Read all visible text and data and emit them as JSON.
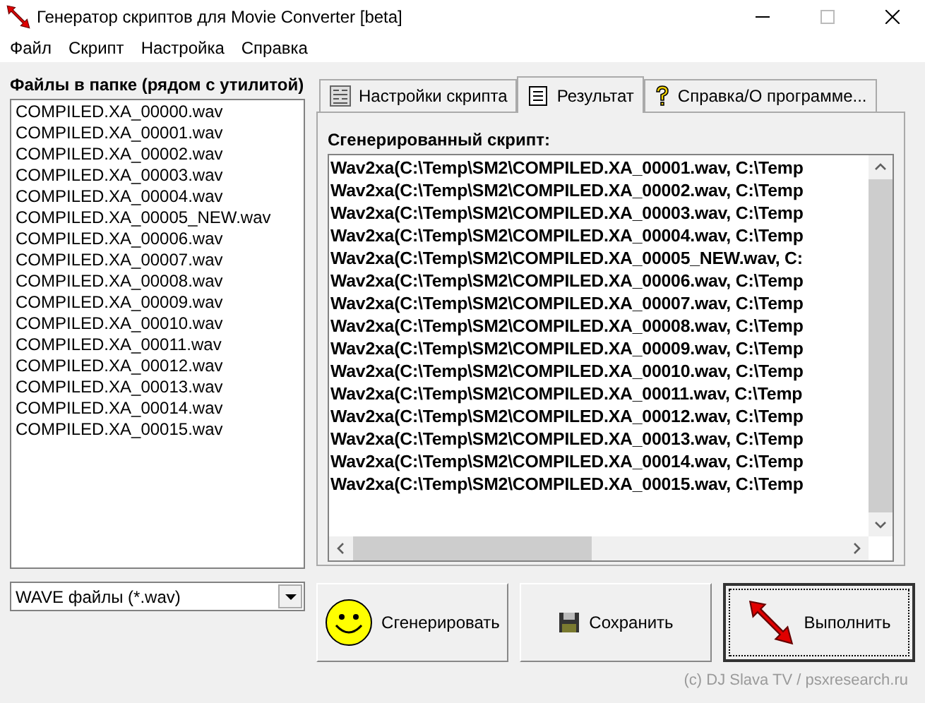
{
  "window": {
    "title": "Генератор скриптов для Movie Converter [beta]"
  },
  "menu": [
    "Файл",
    "Скрипт",
    "Настройка",
    "Справка"
  ],
  "files": {
    "label": "Файлы в папке (рядом с утилитой)",
    "items": [
      "COMPILED.XA_00000.wav",
      "COMPILED.XA_00001.wav",
      "COMPILED.XA_00002.wav",
      "COMPILED.XA_00003.wav",
      "COMPILED.XA_00004.wav",
      "COMPILED.XA_00005_NEW.wav",
      "COMPILED.XA_00006.wav",
      "COMPILED.XA_00007.wav",
      "COMPILED.XA_00008.wav",
      "COMPILED.XA_00009.wav",
      "COMPILED.XA_00010.wav",
      "COMPILED.XA_00011.wav",
      "COMPILED.XA_00012.wav",
      "COMPILED.XA_00013.wav",
      "COMPILED.XA_00014.wav",
      "COMPILED.XA_00015.wav"
    ],
    "filter": "WAVE файлы (*.wav)"
  },
  "tabs": [
    {
      "label": "Настройки скрипта",
      "selected": false,
      "kind": "settings"
    },
    {
      "label": "Результат",
      "selected": true,
      "kind": "result"
    },
    {
      "label": "Справка/О программе...",
      "selected": false,
      "kind": "help"
    }
  ],
  "script": {
    "label": "Сгенерированный скрипт:",
    "lines": [
      "Wav2xa(C:\\Temp\\SM2\\COMPILED.XA_00001.wav, C:\\Temp",
      "Wav2xa(C:\\Temp\\SM2\\COMPILED.XA_00002.wav, C:\\Temp",
      "Wav2xa(C:\\Temp\\SM2\\COMPILED.XA_00003.wav, C:\\Temp",
      "Wav2xa(C:\\Temp\\SM2\\COMPILED.XA_00004.wav, C:\\Temp",
      "Wav2xa(C:\\Temp\\SM2\\COMPILED.XA_00005_NEW.wav, C:",
      "Wav2xa(C:\\Temp\\SM2\\COMPILED.XA_00006.wav, C:\\Temp",
      "Wav2xa(C:\\Temp\\SM2\\COMPILED.XA_00007.wav, C:\\Temp",
      "Wav2xa(C:\\Temp\\SM2\\COMPILED.XA_00008.wav, C:\\Temp",
      "Wav2xa(C:\\Temp\\SM2\\COMPILED.XA_00009.wav, C:\\Temp",
      "Wav2xa(C:\\Temp\\SM2\\COMPILED.XA_00010.wav, C:\\Temp",
      "Wav2xa(C:\\Temp\\SM2\\COMPILED.XA_00011.wav, C:\\Temp",
      "Wav2xa(C:\\Temp\\SM2\\COMPILED.XA_00012.wav, C:\\Temp",
      "Wav2xa(C:\\Temp\\SM2\\COMPILED.XA_00013.wav, C:\\Temp",
      "Wav2xa(C:\\Temp\\SM2\\COMPILED.XA_00014.wav, C:\\Temp",
      "Wav2xa(C:\\Temp\\SM2\\COMPILED.XA_00015.wav, C:\\Temp"
    ]
  },
  "buttons": [
    {
      "label": "Сгенерировать",
      "kind": "smiley",
      "selected": false
    },
    {
      "label": "Сохранить",
      "kind": "save",
      "selected": false
    },
    {
      "label": "Выполнить",
      "kind": "arrows",
      "selected": true
    }
  ],
  "copyright": "(c) DJ Slava TV / psxresearch.ru"
}
